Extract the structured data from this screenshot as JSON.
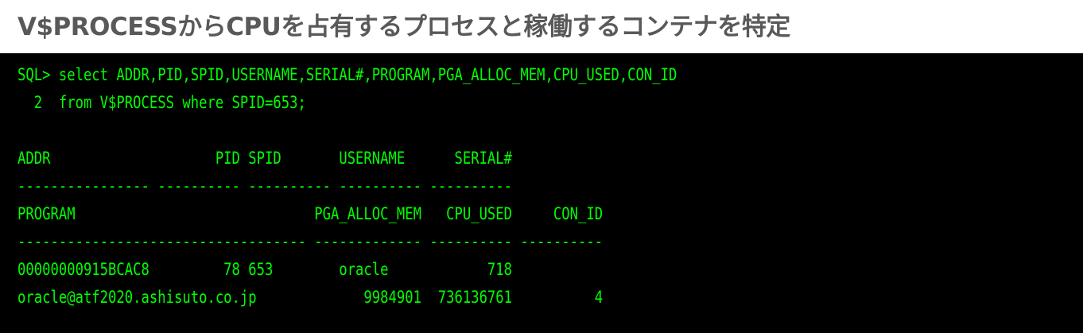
{
  "page": {
    "title": "V$PROCESSからCPUを占有するプロセスと稼働するコンテナを特定"
  },
  "terminal": {
    "text_color": "#00ff00",
    "background": "#000000",
    "lines": [
      "SQL> select ADDR,PID,SPID,USERNAME,SERIAL#,PROGRAM,PGA_ALLOC_MEM,CPU_USED,CON_ID",
      "  2  from V$PROCESS where SPID=653;",
      "",
      "ADDR                    PID SPID       USERNAME      SERIAL#",
      "---------------- ---------- ---------- ---------- ----------",
      "PROGRAM                             PGA_ALLOC_MEM   CPU_USED     CON_ID",
      "----------------------------------- ------------- ---------- ----------",
      "00000000915BCAC8         78 653        oracle            718",
      "oracle@atf2020.ashisuto.co.jp             9984901  736136761          4"
    ]
  }
}
